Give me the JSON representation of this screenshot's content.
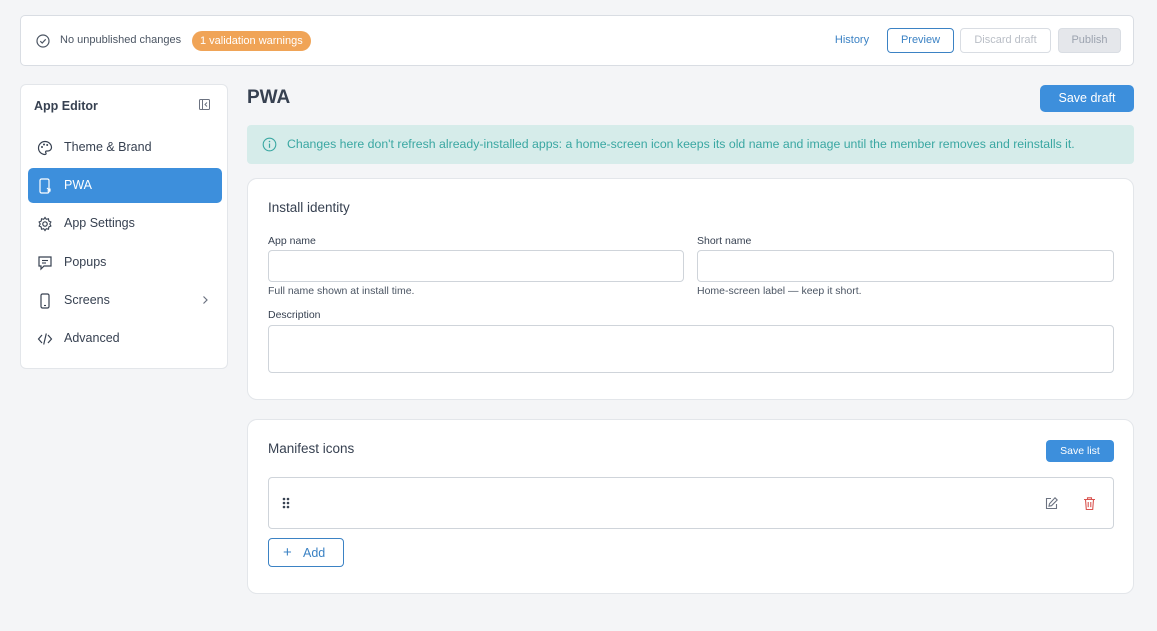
{
  "topbar": {
    "status_text": "No unpublished changes",
    "warning_badge": "1 validation warnings",
    "history_label": "History",
    "preview_label": "Preview",
    "discard_label": "Discard draft",
    "publish_label": "Publish"
  },
  "sidebar": {
    "title": "App Editor",
    "items": [
      {
        "label": "Theme & Brand",
        "icon": "palette-icon",
        "active": false
      },
      {
        "label": "PWA",
        "icon": "phone-install-icon",
        "active": true
      },
      {
        "label": "App Settings",
        "icon": "gear-icon",
        "active": false
      },
      {
        "label": "Popups",
        "icon": "popup-message-icon",
        "active": false
      },
      {
        "label": "Screens",
        "icon": "phone-icon",
        "active": false,
        "has_submenu": true
      },
      {
        "label": "Advanced",
        "icon": "code-icon",
        "active": false
      }
    ]
  },
  "main": {
    "title": "PWA",
    "save_draft_label": "Save draft",
    "info_text": "Changes here don't refresh already-installed apps: a home-screen icon keeps its old name and image until the member removes and reinstalls it."
  },
  "identity": {
    "title": "Install identity",
    "app_name_label": "App name",
    "app_name_value": "",
    "app_name_help": "Full name shown at install time.",
    "short_name_label": "Short name",
    "short_name_value": "",
    "short_name_help": "Home-screen label — keep it short.",
    "description_label": "Description",
    "description_value": ""
  },
  "icons": {
    "title": "Manifest icons",
    "save_list_label": "Save list",
    "add_label": "Add"
  },
  "colors": {
    "accent": "#3d8fdc",
    "warning": "#f0a457",
    "info_bg": "#d6ecea",
    "info_text": "#3aa7a2",
    "danger": "#d9534f"
  }
}
